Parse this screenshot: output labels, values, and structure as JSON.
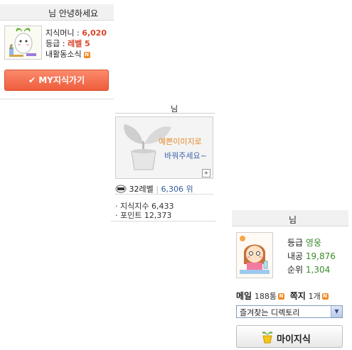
{
  "widget_login": {
    "greeting": "님 안녕하세요",
    "rows": [
      {
        "label": "지식머니 : ",
        "value": "6,020"
      },
      {
        "label": "등급 : ",
        "value": "레벨 5"
      },
      {
        "label": "내활동소식",
        "value": ""
      }
    ],
    "new_badge": "N",
    "my_button": "MY지식가기",
    "check_icon": "✔"
  },
  "widget_profile": {
    "title": "님",
    "image_text_line1": "예쁜이미지로",
    "image_text_line2": "바꿔주세요~",
    "zoom_icon": "+",
    "level": "32레벨",
    "separator": "|",
    "rank": "6,306 위",
    "stats": [
      "· 지식지수 6,433",
      "· 포인트 12,373"
    ]
  },
  "widget_mykin": {
    "title": "님",
    "rows": [
      {
        "label": "등급 ",
        "value": "영웅"
      },
      {
        "label": "내공 ",
        "value": "19,876"
      },
      {
        "label": "순위 ",
        "value": "1,304"
      }
    ],
    "mail_label": "메일",
    "mail_count": "188통",
    "note_label": "쪽지",
    "note_count": "1개",
    "new_badge": "N",
    "dropdown_selected": "즐겨찾는 디렉토리",
    "dropdown_arrow": "▼",
    "my_button": "마이지식"
  },
  "colors": {
    "accent_orange": "#ee5d3c",
    "value_red": "#d9442a",
    "value_green": "#3a8a2a",
    "rank_blue": "#2f5d9c",
    "badge_orange": "#f08a24"
  }
}
